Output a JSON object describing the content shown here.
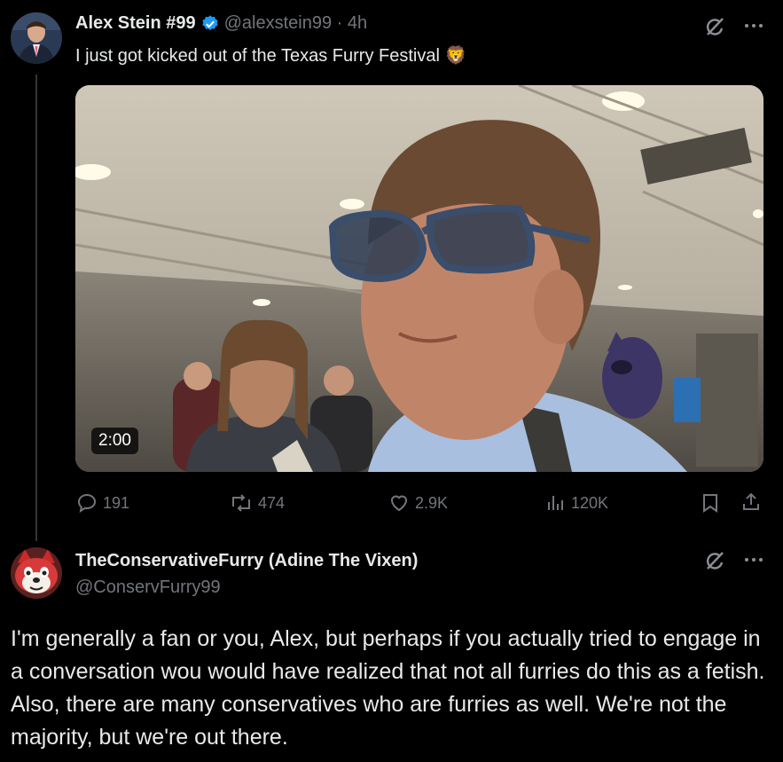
{
  "tweet": {
    "author_name": "Alex Stein #99",
    "handle_time": "@alexstein99 · 4h",
    "text": "I just got kicked out of the Texas Furry Festival 🦁",
    "video_duration": "2:00",
    "stats": {
      "replies": "191",
      "reposts": "474",
      "likes": "2.9K",
      "views": "120K"
    }
  },
  "reply": {
    "author_name": "TheConservativeFurry (Adine The Vixen)",
    "handle": "@ConservFurry99",
    "text": "I'm generally a fan or you, Alex, but perhaps if you actually tried to engage in a conversation wou would have realized that not all furries do this as a fetish. Also, there are many conservatives who are furries as well. We're not the majority, but we're out there."
  },
  "icons": [
    "grok-icon",
    "more-icon",
    "reply-icon",
    "repost-icon",
    "like-icon",
    "views-icon",
    "bookmark-icon",
    "share-icon",
    "verified-badge-icon"
  ],
  "colors": {
    "background": "#000000",
    "text": "#e7e9ea",
    "secondary": "#71767b",
    "verified": "#1d9bf0"
  }
}
